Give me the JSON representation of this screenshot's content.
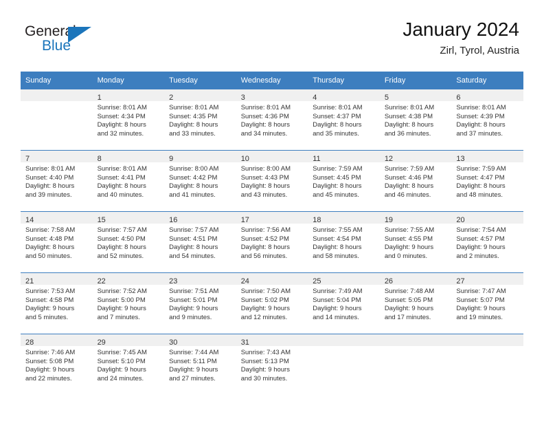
{
  "brand": {
    "name_part1": "General",
    "name_part2": "Blue",
    "accent_color": "#1b75bb",
    "logo_icon": "triangle-flag-icon"
  },
  "header": {
    "title": "January 2024",
    "subtitle": "Zirl, Tyrol, Austria"
  },
  "calendar": {
    "header_bg": "#3d7ebf",
    "daynum_bg": "#f0f0f0",
    "weekday_headers": [
      "Sunday",
      "Monday",
      "Tuesday",
      "Wednesday",
      "Thursday",
      "Friday",
      "Saturday"
    ],
    "weeks": [
      [
        {
          "empty": true
        },
        {
          "day": "1",
          "sunrise": "Sunrise: 8:01 AM",
          "sunset": "Sunset: 4:34 PM",
          "daylight1": "Daylight: 8 hours",
          "daylight2": "and 32 minutes."
        },
        {
          "day": "2",
          "sunrise": "Sunrise: 8:01 AM",
          "sunset": "Sunset: 4:35 PM",
          "daylight1": "Daylight: 8 hours",
          "daylight2": "and 33 minutes."
        },
        {
          "day": "3",
          "sunrise": "Sunrise: 8:01 AM",
          "sunset": "Sunset: 4:36 PM",
          "daylight1": "Daylight: 8 hours",
          "daylight2": "and 34 minutes."
        },
        {
          "day": "4",
          "sunrise": "Sunrise: 8:01 AM",
          "sunset": "Sunset: 4:37 PM",
          "daylight1": "Daylight: 8 hours",
          "daylight2": "and 35 minutes."
        },
        {
          "day": "5",
          "sunrise": "Sunrise: 8:01 AM",
          "sunset": "Sunset: 4:38 PM",
          "daylight1": "Daylight: 8 hours",
          "daylight2": "and 36 minutes."
        },
        {
          "day": "6",
          "sunrise": "Sunrise: 8:01 AM",
          "sunset": "Sunset: 4:39 PM",
          "daylight1": "Daylight: 8 hours",
          "daylight2": "and 37 minutes."
        }
      ],
      [
        {
          "day": "7",
          "sunrise": "Sunrise: 8:01 AM",
          "sunset": "Sunset: 4:40 PM",
          "daylight1": "Daylight: 8 hours",
          "daylight2": "and 39 minutes."
        },
        {
          "day": "8",
          "sunrise": "Sunrise: 8:01 AM",
          "sunset": "Sunset: 4:41 PM",
          "daylight1": "Daylight: 8 hours",
          "daylight2": "and 40 minutes."
        },
        {
          "day": "9",
          "sunrise": "Sunrise: 8:00 AM",
          "sunset": "Sunset: 4:42 PM",
          "daylight1": "Daylight: 8 hours",
          "daylight2": "and 41 minutes."
        },
        {
          "day": "10",
          "sunrise": "Sunrise: 8:00 AM",
          "sunset": "Sunset: 4:43 PM",
          "daylight1": "Daylight: 8 hours",
          "daylight2": "and 43 minutes."
        },
        {
          "day": "11",
          "sunrise": "Sunrise: 7:59 AM",
          "sunset": "Sunset: 4:45 PM",
          "daylight1": "Daylight: 8 hours",
          "daylight2": "and 45 minutes."
        },
        {
          "day": "12",
          "sunrise": "Sunrise: 7:59 AM",
          "sunset": "Sunset: 4:46 PM",
          "daylight1": "Daylight: 8 hours",
          "daylight2": "and 46 minutes."
        },
        {
          "day": "13",
          "sunrise": "Sunrise: 7:59 AM",
          "sunset": "Sunset: 4:47 PM",
          "daylight1": "Daylight: 8 hours",
          "daylight2": "and 48 minutes."
        }
      ],
      [
        {
          "day": "14",
          "sunrise": "Sunrise: 7:58 AM",
          "sunset": "Sunset: 4:48 PM",
          "daylight1": "Daylight: 8 hours",
          "daylight2": "and 50 minutes."
        },
        {
          "day": "15",
          "sunrise": "Sunrise: 7:57 AM",
          "sunset": "Sunset: 4:50 PM",
          "daylight1": "Daylight: 8 hours",
          "daylight2": "and 52 minutes."
        },
        {
          "day": "16",
          "sunrise": "Sunrise: 7:57 AM",
          "sunset": "Sunset: 4:51 PM",
          "daylight1": "Daylight: 8 hours",
          "daylight2": "and 54 minutes."
        },
        {
          "day": "17",
          "sunrise": "Sunrise: 7:56 AM",
          "sunset": "Sunset: 4:52 PM",
          "daylight1": "Daylight: 8 hours",
          "daylight2": "and 56 minutes."
        },
        {
          "day": "18",
          "sunrise": "Sunrise: 7:55 AM",
          "sunset": "Sunset: 4:54 PM",
          "daylight1": "Daylight: 8 hours",
          "daylight2": "and 58 minutes."
        },
        {
          "day": "19",
          "sunrise": "Sunrise: 7:55 AM",
          "sunset": "Sunset: 4:55 PM",
          "daylight1": "Daylight: 9 hours",
          "daylight2": "and 0 minutes."
        },
        {
          "day": "20",
          "sunrise": "Sunrise: 7:54 AM",
          "sunset": "Sunset: 4:57 PM",
          "daylight1": "Daylight: 9 hours",
          "daylight2": "and 2 minutes."
        }
      ],
      [
        {
          "day": "21",
          "sunrise": "Sunrise: 7:53 AM",
          "sunset": "Sunset: 4:58 PM",
          "daylight1": "Daylight: 9 hours",
          "daylight2": "and 5 minutes."
        },
        {
          "day": "22",
          "sunrise": "Sunrise: 7:52 AM",
          "sunset": "Sunset: 5:00 PM",
          "daylight1": "Daylight: 9 hours",
          "daylight2": "and 7 minutes."
        },
        {
          "day": "23",
          "sunrise": "Sunrise: 7:51 AM",
          "sunset": "Sunset: 5:01 PM",
          "daylight1": "Daylight: 9 hours",
          "daylight2": "and 9 minutes."
        },
        {
          "day": "24",
          "sunrise": "Sunrise: 7:50 AM",
          "sunset": "Sunset: 5:02 PM",
          "daylight1": "Daylight: 9 hours",
          "daylight2": "and 12 minutes."
        },
        {
          "day": "25",
          "sunrise": "Sunrise: 7:49 AM",
          "sunset": "Sunset: 5:04 PM",
          "daylight1": "Daylight: 9 hours",
          "daylight2": "and 14 minutes."
        },
        {
          "day": "26",
          "sunrise": "Sunrise: 7:48 AM",
          "sunset": "Sunset: 5:05 PM",
          "daylight1": "Daylight: 9 hours",
          "daylight2": "and 17 minutes."
        },
        {
          "day": "27",
          "sunrise": "Sunrise: 7:47 AM",
          "sunset": "Sunset: 5:07 PM",
          "daylight1": "Daylight: 9 hours",
          "daylight2": "and 19 minutes."
        }
      ],
      [
        {
          "day": "28",
          "sunrise": "Sunrise: 7:46 AM",
          "sunset": "Sunset: 5:08 PM",
          "daylight1": "Daylight: 9 hours",
          "daylight2": "and 22 minutes."
        },
        {
          "day": "29",
          "sunrise": "Sunrise: 7:45 AM",
          "sunset": "Sunset: 5:10 PM",
          "daylight1": "Daylight: 9 hours",
          "daylight2": "and 24 minutes."
        },
        {
          "day": "30",
          "sunrise": "Sunrise: 7:44 AM",
          "sunset": "Sunset: 5:11 PM",
          "daylight1": "Daylight: 9 hours",
          "daylight2": "and 27 minutes."
        },
        {
          "day": "31",
          "sunrise": "Sunrise: 7:43 AM",
          "sunset": "Sunset: 5:13 PM",
          "daylight1": "Daylight: 9 hours",
          "daylight2": "and 30 minutes."
        },
        {
          "empty": true
        },
        {
          "empty": true
        },
        {
          "empty": true
        }
      ]
    ]
  }
}
